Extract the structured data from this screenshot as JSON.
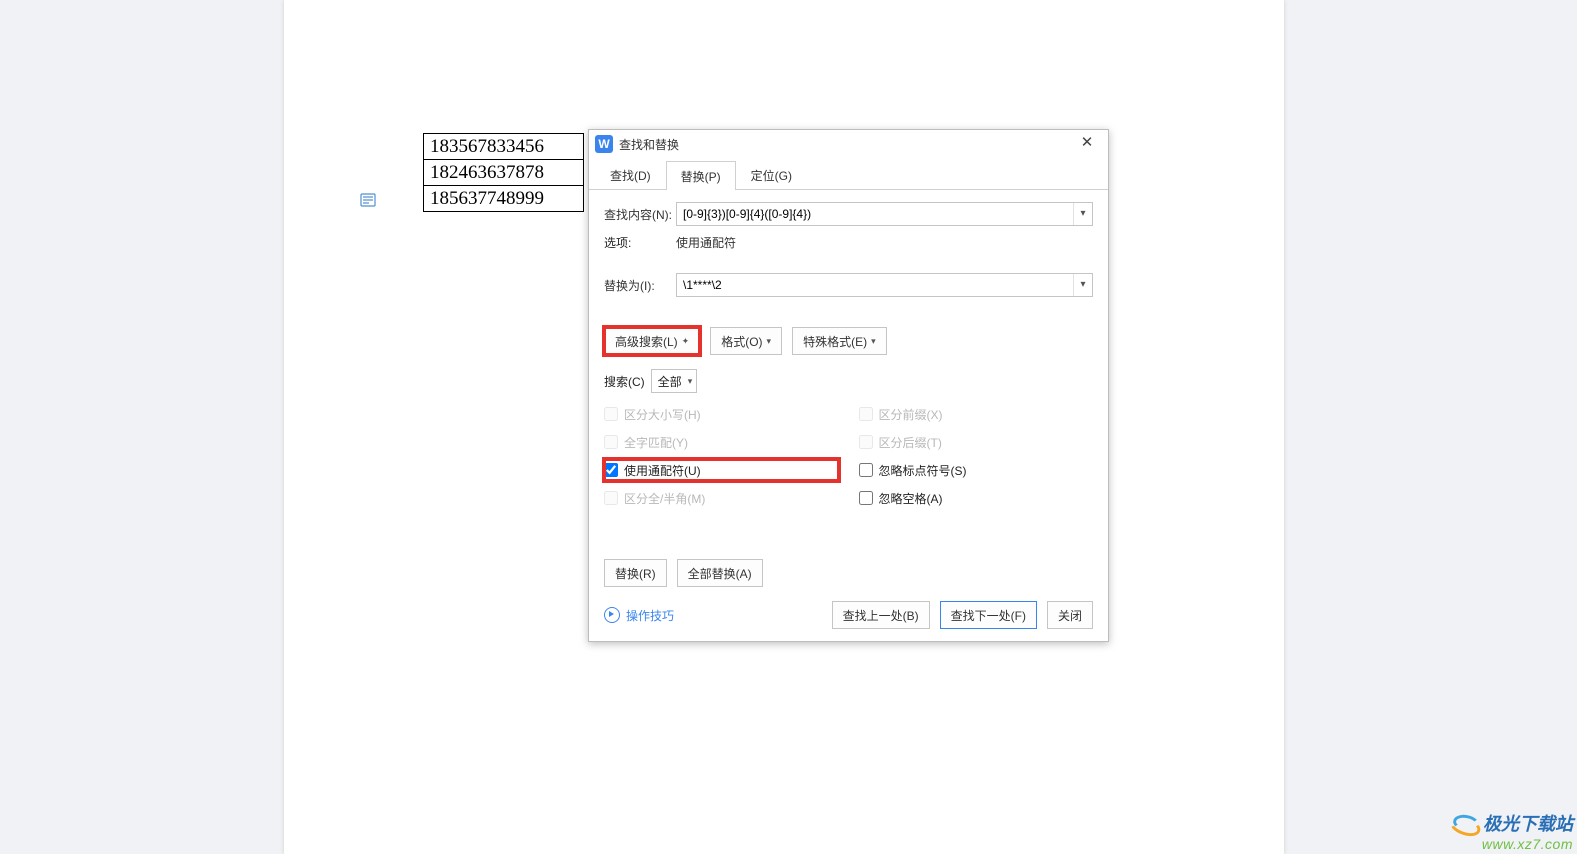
{
  "doc": {
    "table_rows": [
      "183567833456",
      "182463637878",
      "185637748999"
    ]
  },
  "dialog": {
    "title_icon": "W",
    "title": "查找和替换",
    "tabs": {
      "find": "查找(D)",
      "replace": "替换(P)",
      "goto": "定位(G)"
    },
    "labels": {
      "find_content": "查找内容(N):",
      "options": "选项:",
      "replace_with": "替换为(I):",
      "search_scope": "搜索(C)"
    },
    "find_value": "[0-9]{3})[0-9]{4}([0-9]{4})",
    "options_value": "使用通配符",
    "replace_value": "\\1****\\2",
    "buttons": {
      "advanced": "高级搜索(L)",
      "format": "格式(O)",
      "special": "特殊格式(E)",
      "replace": "替换(R)",
      "replace_all": "全部替换(A)",
      "find_prev": "查找上一处(B)",
      "find_next": "查找下一处(F)",
      "close": "关闭"
    },
    "scope_value": "全部",
    "checks": {
      "case": "区分大小写(H)",
      "whole": "全字匹配(Y)",
      "wildcard": "使用通配符(U)",
      "fullhalf": "区分全/半角(M)",
      "prefix": "区分前缀(X)",
      "suffix": "区分后缀(T)",
      "ignore_punct": "忽略标点符号(S)",
      "ignore_space": "忽略空格(A)"
    },
    "tips": "操作技巧"
  },
  "watermark": {
    "line1": "极光下载站",
    "line2": "www.xz7.com"
  }
}
